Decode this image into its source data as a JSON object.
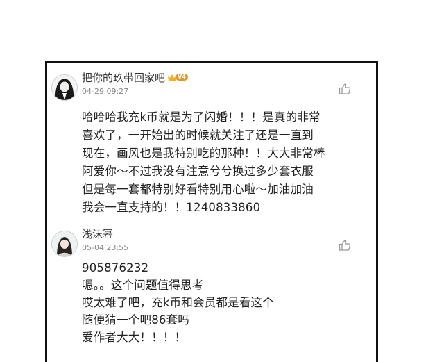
{
  "comments": [
    {
      "username": "把你的玖带回家吧",
      "vip_level": "V4",
      "time": "04-29 09:27",
      "lines": [
        "哈哈哈我充k币就是为了闪婚！！！是真的非常",
        "喜欢了，一开始出的时候就关注了还是一直到",
        "现在，画风也是我特别吃的那种！！大大非常棒",
        "阿爱你～不过我没有注意兮兮换过多少套衣服",
        "但是每一套都特别好看特别用心啦～加油加油",
        "我会一直支持的！！1240833860"
      ]
    },
    {
      "username": "浅沫幂",
      "time": "05-04 23:55",
      "lines": [
        "905876232",
        "嗯。。这个问题值得思考",
        "哎太难了吧，充k币和会员都是看这个",
        "随便猜一个吧86套吗",
        "爱作者大大！！！！"
      ]
    }
  ],
  "icons": {
    "like": "thumbs-up-icon",
    "crown": "crown-icon"
  },
  "colors": {
    "text": "#222222",
    "meta": "#888888",
    "vip_badge": "#e09a28"
  }
}
